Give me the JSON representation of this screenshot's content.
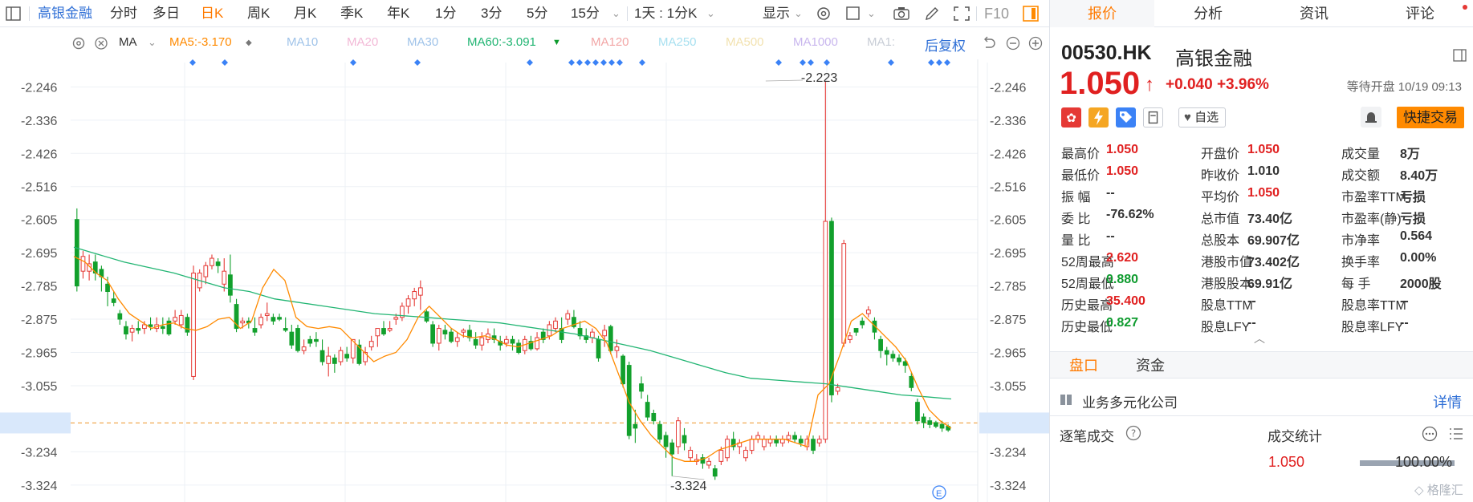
{
  "toolbar": {
    "stock_name": "高银金融",
    "tabs": [
      "分时",
      "多日",
      "日K",
      "周K",
      "月K",
      "季K",
      "年K",
      "1分",
      "3分",
      "5分",
      "15分"
    ],
    "active_tab": "日K",
    "interval": "1天 : 1分K",
    "display": "显示",
    "f10": "F10"
  },
  "indicators": {
    "ma_label": "MA",
    "items": [
      {
        "label": "MA5:",
        "value": "-3.170",
        "color": "#ff8a00"
      },
      {
        "label": "MA10",
        "value": "",
        "color": "#9fc3e9"
      },
      {
        "label": "MA20",
        "value": "",
        "color": "#f2b8d6"
      },
      {
        "label": "MA30",
        "value": "",
        "color": "#9fc3e9"
      },
      {
        "label": "MA60:",
        "value": "-3.091",
        "color": "#22b573"
      },
      {
        "label": "MA120",
        "value": "",
        "color": "#f2a6a6"
      },
      {
        "label": "MA250",
        "value": "",
        "color": "#a8e0f0"
      },
      {
        "label": "MA500",
        "value": "",
        "color": "#f2e2b0"
      },
      {
        "label": "MA1000",
        "value": "",
        "color": "#c9b7ee"
      },
      {
        "label": "MA1:",
        "value": "",
        "color": "#c8cdd6"
      }
    ],
    "adjust": "后复权"
  },
  "chart_data": {
    "type": "candlestick",
    "y_ticks": [
      "-2.246",
      "-2.336",
      "-2.426",
      "-2.516",
      "-2.605",
      "-2.695",
      "-2.785",
      "-2.875",
      "-2.965",
      "-3.055",
      "-3.156",
      "-3.234",
      "-3.324"
    ],
    "ylim": [
      -3.37,
      -2.18
    ],
    "current_price": "-3.156",
    "high_annotation": "-2.223",
    "low_annotation": "-3.324",
    "ma5_latest": -3.17,
    "ma60_latest": -3.091,
    "candles": [
      [
        -2.605,
        -2.785,
        -2.575,
        -2.8
      ],
      [
        -2.745,
        -2.705,
        -2.69,
        -2.765
      ],
      [
        -2.745,
        -2.725,
        -2.7,
        -2.77
      ],
      [
        -2.72,
        -2.75,
        -2.7,
        -2.77
      ],
      [
        -2.74,
        -2.76,
        -2.73,
        -2.8
      ],
      [
        -2.78,
        -2.8,
        -2.76,
        -2.84
      ],
      [
        -2.82,
        -2.83,
        -2.8,
        -2.84
      ],
      [
        -2.86,
        -2.875,
        -2.85,
        -2.89
      ],
      [
        -2.895,
        -2.915,
        -2.88,
        -2.93
      ],
      [
        -2.91,
        -2.9,
        -2.89,
        -2.935
      ],
      [
        -2.9,
        -2.905,
        -2.88,
        -2.915
      ],
      [
        -2.9,
        -2.89,
        -2.88,
        -2.915
      ],
      [
        -2.89,
        -2.895,
        -2.87,
        -2.905
      ],
      [
        -2.9,
        -2.89,
        -2.87,
        -2.91
      ],
      [
        -2.895,
        -2.9,
        -2.87,
        -2.915
      ],
      [
        -2.88,
        -2.915,
        -2.87,
        -2.92
      ],
      [
        -2.88,
        -2.87,
        -2.85,
        -2.89
      ],
      [
        -2.89,
        -2.865,
        -2.85,
        -2.9
      ],
      [
        -2.87,
        -2.91,
        -2.86,
        -2.92
      ],
      [
        -3.03,
        -2.75,
        -2.73,
        -3.04
      ],
      [
        -2.79,
        -2.75,
        -2.74,
        -2.8
      ],
      [
        -2.76,
        -2.73,
        -2.72,
        -2.78
      ],
      [
        -2.73,
        -2.71,
        -2.7,
        -2.74
      ],
      [
        -2.72,
        -2.73,
        -2.71,
        -2.75
      ],
      [
        -2.78,
        -2.745,
        -2.71,
        -2.8
      ],
      [
        -2.755,
        -2.81,
        -2.7,
        -2.83
      ],
      [
        -2.835,
        -2.9,
        -2.82,
        -2.91
      ],
      [
        -2.885,
        -2.88,
        -2.87,
        -2.9
      ],
      [
        -2.88,
        -2.885,
        -2.87,
        -2.9
      ],
      [
        -2.9,
        -2.91,
        -2.87,
        -2.92
      ],
      [
        -2.89,
        -2.87,
        -2.86,
        -2.9
      ],
      [
        -2.865,
        -2.86,
        -2.83,
        -2.88
      ],
      [
        -2.87,
        -2.88,
        -2.86,
        -2.89
      ],
      [
        -2.87,
        -2.875,
        -2.86,
        -2.88
      ],
      [
        -2.9,
        -2.905,
        -2.87,
        -2.91
      ],
      [
        -2.91,
        -2.945,
        -2.89,
        -2.955
      ],
      [
        -2.9,
        -2.96,
        -2.89,
        -2.965
      ],
      [
        -2.96,
        -2.95,
        -2.93,
        -2.97
      ],
      [
        -2.93,
        -2.94,
        -2.92,
        -2.95
      ],
      [
        -2.93,
        -2.935,
        -2.91,
        -2.95
      ],
      [
        -2.96,
        -2.99,
        -2.93,
        -3.0
      ],
      [
        -2.995,
        -2.975,
        -2.95,
        -3.03
      ],
      [
        -2.98,
        -2.995,
        -2.97,
        -3.02
      ],
      [
        -2.99,
        -2.96,
        -2.95,
        -3.0
      ],
      [
        -2.97,
        -2.98,
        -2.95,
        -2.99
      ],
      [
        -2.98,
        -2.93,
        -2.93,
        -2.995
      ],
      [
        -2.945,
        -2.995,
        -2.93,
        -3.0
      ],
      [
        -2.99,
        -2.965,
        -2.95,
        -3.0
      ],
      [
        -2.95,
        -2.935,
        -2.92,
        -2.96
      ],
      [
        -2.92,
        -2.9,
        -2.9,
        -2.95
      ],
      [
        -2.9,
        -2.915,
        -2.88,
        -2.92
      ],
      [
        -2.905,
        -2.9,
        -2.88,
        -2.91
      ],
      [
        -2.875,
        -2.87,
        -2.86,
        -2.89
      ],
      [
        -2.87,
        -2.84,
        -2.83,
        -2.88
      ],
      [
        -2.84,
        -2.82,
        -2.81,
        -2.86
      ],
      [
        -2.82,
        -2.8,
        -2.79,
        -2.84
      ],
      [
        -2.81,
        -2.79,
        -2.77,
        -2.85
      ],
      [
        -2.855,
        -2.88,
        -2.85,
        -2.885
      ],
      [
        -2.89,
        -2.94,
        -2.88,
        -2.95
      ],
      [
        -2.94,
        -2.9,
        -2.89,
        -2.96
      ],
      [
        -2.905,
        -2.915,
        -2.89,
        -2.93
      ],
      [
        -2.91,
        -2.935,
        -2.9,
        -2.94
      ],
      [
        -2.935,
        -2.925,
        -2.91,
        -2.95
      ],
      [
        -2.91,
        -2.905,
        -2.9,
        -2.925
      ],
      [
        -2.905,
        -2.925,
        -2.89,
        -2.935
      ],
      [
        -2.93,
        -2.945,
        -2.91,
        -2.955
      ],
      [
        -2.945,
        -2.925,
        -2.91,
        -2.96
      ],
      [
        -2.93,
        -2.915,
        -2.9,
        -2.94
      ],
      [
        -2.92,
        -2.93,
        -2.9,
        -2.94
      ],
      [
        -2.935,
        -2.945,
        -2.92,
        -2.96
      ],
      [
        -2.94,
        -2.93,
        -2.92,
        -2.95
      ],
      [
        -2.93,
        -2.94,
        -2.92,
        -2.96
      ],
      [
        -2.94,
        -2.965,
        -2.93,
        -2.97
      ],
      [
        -2.96,
        -2.93,
        -2.92,
        -2.97
      ],
      [
        -2.935,
        -2.955,
        -2.92,
        -2.96
      ],
      [
        -2.955,
        -2.925,
        -2.91,
        -2.96
      ],
      [
        -2.91,
        -2.93,
        -2.9,
        -2.94
      ],
      [
        -2.92,
        -2.89,
        -2.88,
        -2.93
      ],
      [
        -2.9,
        -2.88,
        -2.87,
        -2.91
      ],
      [
        -2.9,
        -2.93,
        -2.87,
        -2.94
      ],
      [
        -2.875,
        -2.86,
        -2.85,
        -2.89
      ],
      [
        -2.87,
        -2.895,
        -2.85,
        -2.9
      ],
      [
        -2.9,
        -2.92,
        -2.88,
        -2.93
      ],
      [
        -2.92,
        -2.93,
        -2.9,
        -2.94
      ],
      [
        -2.925,
        -2.91,
        -2.9,
        -2.94
      ],
      [
        -2.93,
        -2.98,
        -2.92,
        -2.99
      ],
      [
        -2.92,
        -2.905,
        -2.89,
        -2.95
      ],
      [
        -2.895,
        -2.96,
        -2.89,
        -2.97
      ],
      [
        -2.96,
        -2.95,
        -2.93,
        -2.98
      ],
      [
        -2.975,
        -3.05,
        -2.97,
        -3.06
      ],
      [
        -3.0,
        -3.19,
        -2.99,
        -3.2
      ],
      [
        -3.16,
        -3.17,
        -3.12,
        -3.21
      ],
      [
        -3.05,
        -3.07,
        -3.03,
        -3.09
      ],
      [
        -3.1,
        -3.14,
        -3.08,
        -3.15
      ],
      [
        -3.13,
        -3.15,
        -3.12,
        -3.16
      ],
      [
        -3.16,
        -3.2,
        -3.15,
        -3.21
      ],
      [
        -3.19,
        -3.22,
        -3.18,
        -3.25
      ],
      [
        -3.21,
        -3.24,
        -3.2,
        -3.3
      ],
      [
        -3.22,
        -3.15,
        -3.14,
        -3.24
      ],
      [
        -3.19,
        -3.21,
        -3.17,
        -3.23
      ],
      [
        -3.25,
        -3.23,
        -3.22,
        -3.26
      ],
      [
        -3.26,
        -3.255,
        -3.24,
        -3.27
      ],
      [
        -3.25,
        -3.265,
        -3.24,
        -3.28
      ],
      [
        -3.27,
        -3.26,
        -3.25,
        -3.28
      ],
      [
        -3.28,
        -3.3,
        -3.27,
        -3.31
      ],
      [
        -3.26,
        -3.23,
        -3.22,
        -3.27
      ],
      [
        -3.25,
        -3.2,
        -3.19,
        -3.26
      ],
      [
        -3.2,
        -3.22,
        -3.18,
        -3.23
      ],
      [
        -3.22,
        -3.21,
        -3.2,
        -3.24
      ],
      [
        -3.25,
        -3.23,
        -3.22,
        -3.26
      ],
      [
        -3.23,
        -3.2,
        -3.19,
        -3.24
      ],
      [
        -3.2,
        -3.19,
        -3.18,
        -3.21
      ],
      [
        -3.22,
        -3.2,
        -3.19,
        -3.23
      ],
      [
        -3.21,
        -3.2,
        -3.19,
        -3.22
      ],
      [
        -3.2,
        -3.21,
        -3.19,
        -3.22
      ],
      [
        -3.21,
        -3.2,
        -3.19,
        -3.22
      ],
      [
        -3.2,
        -3.19,
        -3.18,
        -3.21
      ],
      [
        -3.19,
        -3.2,
        -3.18,
        -3.21
      ],
      [
        -3.2,
        -3.21,
        -3.19,
        -3.22
      ],
      [
        -3.22,
        -3.2,
        -3.19,
        -3.23
      ],
      [
        -3.2,
        -3.23,
        -3.19,
        -3.24
      ],
      [
        -3.21,
        -3.2,
        -3.19,
        -3.22
      ],
      [
        -3.2,
        -2.61,
        -2.23,
        -3.21
      ],
      [
        -2.61,
        -3.08,
        -2.6,
        -3.1
      ],
      [
        -3.07,
        -3.06,
        -3.05,
        -3.08
      ],
      [
        -2.94,
        -2.67,
        -2.66,
        -2.95
      ],
      [
        -2.93,
        -2.92,
        -2.91,
        -2.94
      ],
      [
        -2.9,
        -2.91,
        -2.9,
        -2.92
      ],
      [
        -2.88,
        -2.89,
        -2.87,
        -2.9
      ],
      [
        -2.86,
        -2.85,
        -2.84,
        -2.87
      ],
      [
        -2.88,
        -2.91,
        -2.87,
        -2.93
      ],
      [
        -2.93,
        -2.96,
        -2.92,
        -2.98
      ],
      [
        -2.96,
        -2.97,
        -2.95,
        -3.0
      ],
      [
        -2.97,
        -2.98,
        -2.96,
        -2.99
      ],
      [
        -2.98,
        -2.99,
        -2.97,
        -3.0
      ],
      [
        -2.99,
        -3.0,
        -2.98,
        -3.02
      ],
      [
        -3.03,
        -3.06,
        -3.02,
        -3.07
      ],
      [
        -3.1,
        -3.15,
        -3.09,
        -3.16
      ],
      [
        -3.14,
        -3.155,
        -3.13,
        -3.17
      ],
      [
        -3.15,
        -3.16,
        -3.14,
        -3.17
      ],
      [
        -3.155,
        -3.165,
        -3.15,
        -3.17
      ],
      [
        -3.16,
        -3.17,
        -3.15,
        -3.18
      ],
      [
        -3.165,
        -3.175,
        -3.16,
        -3.18
      ]
    ],
    "ma5": [
      -2.705,
      -2.72,
      -2.75,
      -2.77,
      -2.82,
      -2.86,
      -2.88,
      -2.9,
      -2.89,
      -2.885,
      -2.9,
      -2.905,
      -2.895,
      -2.875,
      -2.87,
      -2.9,
      -2.88,
      -2.79,
      -2.74,
      -2.77,
      -2.87,
      -2.895,
      -2.9,
      -2.895,
      -2.9,
      -2.93,
      -2.96,
      -2.99,
      -2.975,
      -2.965,
      -2.93,
      -2.87,
      -2.84,
      -2.87,
      -2.9,
      -2.92,
      -2.925,
      -2.92,
      -2.93,
      -2.945,
      -2.95,
      -2.94,
      -2.93,
      -2.92,
      -2.9,
      -2.89,
      -2.88,
      -2.9,
      -2.94,
      -3.02,
      -3.1,
      -3.15,
      -3.19,
      -3.22,
      -3.25,
      -3.26,
      -3.26,
      -3.25,
      -3.23,
      -3.22,
      -3.21,
      -3.2,
      -3.2,
      -3.2,
      -3.2,
      -3.21,
      -3.22,
      -3.08,
      -3.05,
      -2.97,
      -2.88,
      -2.86,
      -2.89,
      -2.92,
      -2.95,
      -2.99,
      -3.06,
      -3.12,
      -3.15,
      -3.17
    ],
    "ma60": [
      -2.68,
      -2.7,
      -2.72,
      -2.735,
      -2.75,
      -2.77,
      -2.79,
      -2.8,
      -2.82,
      -2.83,
      -2.84,
      -2.85,
      -2.86,
      -2.865,
      -2.87,
      -2.875,
      -2.88,
      -2.885,
      -2.895,
      -2.905,
      -2.915,
      -2.93,
      -2.945,
      -2.96,
      -2.98,
      -3.0,
      -3.02,
      -3.035,
      -3.04,
      -3.045,
      -3.05,
      -3.06,
      -3.07,
      -3.08,
      -3.085,
      -3.091
    ]
  },
  "quote": {
    "code": "00530.HK",
    "name": "高银金融",
    "price": "1.050",
    "change": "+0.040",
    "change_pct": "+3.96%",
    "status": "等待开盘 10/19 09:13",
    "watchlist": "自选",
    "trade": "快捷交易",
    "rows": [
      [
        {
          "label": "最高价",
          "value": "1.050",
          "color": "red"
        },
        {
          "label": "开盘价",
          "value": "1.050",
          "color": "red"
        },
        {
          "label": "成交量",
          "value": "8万",
          "color": "dark"
        }
      ],
      [
        {
          "label": "最低价",
          "value": "1.050",
          "color": "red"
        },
        {
          "label": "昨收价",
          "value": "1.010",
          "color": "dark"
        },
        {
          "label": "成交额",
          "value": "8.40万",
          "color": "dark"
        }
      ],
      [
        {
          "label": "振    幅",
          "value": "--",
          "color": "dark"
        },
        {
          "label": "平均价",
          "value": "1.050",
          "color": "red"
        },
        {
          "label": "市盈率TTM",
          "value": "亏损",
          "color": "dark"
        }
      ],
      [
        {
          "label": "委    比",
          "value": "-76.62%",
          "color": "dark"
        },
        {
          "label": "总市值",
          "value": "73.40亿",
          "color": "dark"
        },
        {
          "label": "市盈率(静)",
          "value": "亏损",
          "color": "dark"
        }
      ],
      [
        {
          "label": "量    比",
          "value": "--",
          "color": "dark"
        },
        {
          "label": "总股本",
          "value": "69.907亿",
          "color": "dark"
        },
        {
          "label": "市净率",
          "value": "0.564",
          "color": "dark"
        }
      ],
      [
        {
          "label": "52周最高",
          "value": "2.620",
          "color": "red"
        },
        {
          "label": "港股市值",
          "value": "73.402亿",
          "color": "dark"
        },
        {
          "label": "换手率",
          "value": "0.00%",
          "color": "dark"
        }
      ],
      [
        {
          "label": "52周最低",
          "value": "0.880",
          "color": "green"
        },
        {
          "label": "港股股本",
          "value": "69.91亿",
          "color": "dark"
        },
        {
          "label": "每    手",
          "value": "2000股",
          "color": "dark"
        }
      ],
      [
        {
          "label": "历史最高",
          "value": "35.400",
          "color": "red"
        },
        {
          "label": "股息TTM",
          "value": "--",
          "color": "dark"
        },
        {
          "label": "股息率TTM",
          "value": "--",
          "color": "dark"
        }
      ],
      [
        {
          "label": "历史最低",
          "value": "0.827",
          "color": "green"
        },
        {
          "label": "股息LFY",
          "value": "--",
          "color": "dark"
        },
        {
          "label": "股息率LFY",
          "value": "--",
          "color": "dark"
        }
      ]
    ]
  },
  "panel": {
    "tabs": [
      "报价",
      "分析",
      "资讯",
      "评论"
    ],
    "active_tab": "报价",
    "subtabs": [
      "盘口",
      "资金"
    ],
    "business": "业务多元化公司",
    "detail": "详情",
    "ticks_title": "逐笔成交",
    "stats_title": "成交统计",
    "stats_price": "1.050",
    "stats_pct": "100.00%",
    "watermark": "格隆汇"
  }
}
